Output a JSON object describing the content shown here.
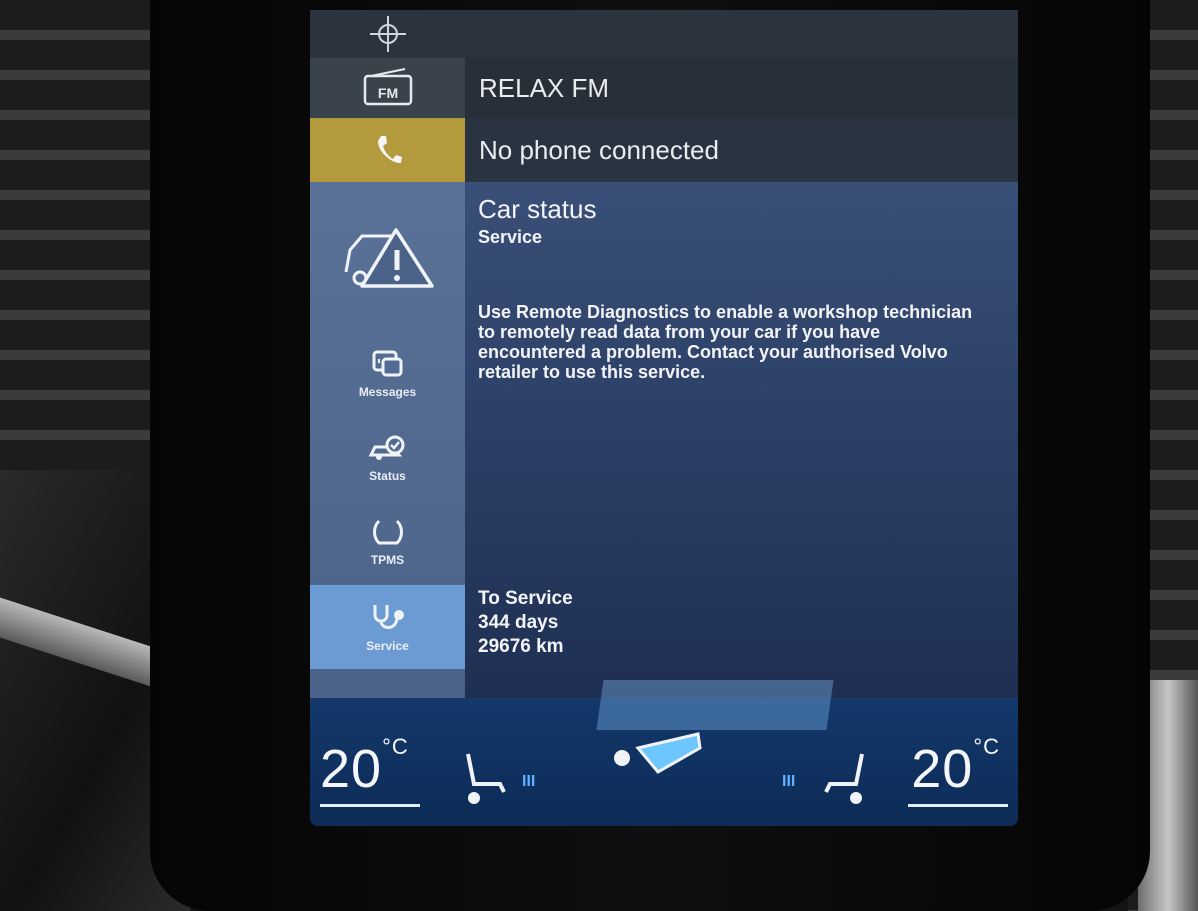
{
  "media": {
    "source_label": "RELAX FM",
    "radio_icon": "fm-radio-icon",
    "radio_badge": "FM"
  },
  "phone": {
    "status": "No phone connected",
    "icon": "phone-icon"
  },
  "car_status": {
    "title": "Car status",
    "subtitle": "Service",
    "description": "Use Remote Diagnostics to enable a workshop technician to remotely read data from your car if you have encountered a problem. Contact your authorised Volvo retailer to use this service.",
    "to_service": {
      "label": "To Service",
      "days": "344 days",
      "distance": "29676 km"
    }
  },
  "sidebar": {
    "items": [
      {
        "label": "Messages",
        "icon": "messages-icon",
        "active": false
      },
      {
        "label": "Status",
        "icon": "car-check-icon",
        "active": false
      },
      {
        "label": "TPMS",
        "icon": "tire-pressure-icon",
        "active": false
      },
      {
        "label": "Service",
        "icon": "stethoscope-icon",
        "active": true
      }
    ]
  },
  "climate": {
    "left_temp": "20",
    "right_temp": "20",
    "unit": "°C",
    "seat_heat_levels_label": "III"
  },
  "colors": {
    "phone_accent": "#b29a3d",
    "panel_bg": "#3a4f77",
    "active_item": "#6c9ad2",
    "climate_bg": "#13386a"
  }
}
